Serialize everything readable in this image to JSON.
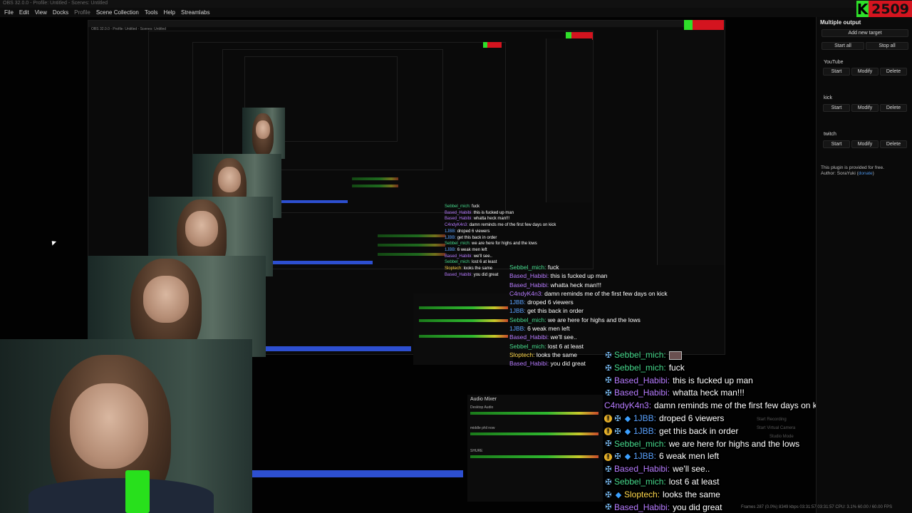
{
  "window": {
    "title": "OBS 32.0.0 - Profile: Untitled - Scenes: Untitled"
  },
  "menubar": {
    "items": [
      "File",
      "Edit",
      "View",
      "Docks",
      "Profile",
      "Scene Collection",
      "Tools",
      "Help",
      "Streamlabs"
    ]
  },
  "kick_badge": {
    "icon_letter": "K",
    "viewer_count": "2509",
    "colors": {
      "icon_bg": "#2fe02a",
      "count_bg": "#d4141f"
    }
  },
  "dock": {
    "title": "Multiple output",
    "add_target": "Add new target",
    "start_all": "Start all",
    "stop_all": "Stop all",
    "targets": [
      {
        "name": "YouTube",
        "start": "Start",
        "modify": "Modify",
        "delete": "Delete"
      },
      {
        "name": "kick",
        "start": "Start",
        "modify": "Modify",
        "delete": "Delete"
      },
      {
        "name": "twitch",
        "start": "Start",
        "modify": "Modify",
        "delete": "Delete"
      }
    ],
    "note_line1": "This plugin is provided for free.",
    "note_line2_prefix": "Author: SoraYuki (",
    "note_link": "donate",
    "note_line2_suffix": ")"
  },
  "mixer": {
    "title": "Audio Mixer",
    "channels": [
      "Desktop Audio",
      "middle phil now",
      "SHURE"
    ]
  },
  "chat": {
    "rows": [
      {
        "badge": "sword",
        "user": "Sebbel_mich:",
        "user_color": "green",
        "text": ""
      },
      {
        "badge": "sword",
        "user": "Sebbel_mich:",
        "user_color": "green",
        "text": "fuck"
      },
      {
        "badge": "sword",
        "user": "Based_Habibi:",
        "user_color": "purple",
        "text": "this is fucked up man"
      },
      {
        "badge": "sword",
        "user": "Based_Habibi:",
        "user_color": "purple",
        "text": "whatta heck man!!!"
      },
      {
        "badge": "",
        "user": "C4ndyK4n3:",
        "user_color": "purple",
        "text": "damn reminds me of the first few days on kick"
      },
      {
        "badge": "gold",
        "user": "1JBB:",
        "user_color": "blue",
        "text": "droped 6 viewers"
      },
      {
        "badge": "gold",
        "user": "1JBB:",
        "user_color": "blue",
        "text": "get this back in order"
      },
      {
        "badge": "sword",
        "user": "Sebbel_mich:",
        "user_color": "green",
        "text": "we are here for highs and the lows"
      },
      {
        "badge": "gold",
        "user": "1JBB:",
        "user_color": "blue",
        "text": "6 weak men left"
      },
      {
        "badge": "sword",
        "user": "Based_Habibi:",
        "user_color": "purple",
        "text": "we'll see.."
      },
      {
        "badge": "sword",
        "user": "Sebbel_mich:",
        "user_color": "green",
        "text": "lost 6 at least"
      },
      {
        "badge": "sword",
        "user": "Sloptech:",
        "user_color": "yellow",
        "text": "looks the same"
      },
      {
        "badge": "sword",
        "user": "Based_Habibi:",
        "user_color": "purple",
        "text": "you did great"
      }
    ]
  },
  "controls": {
    "start_recording": "Start Recording",
    "start_virtual_camera": "Start Virtual Camera",
    "studio_mode": "Studio Mode"
  },
  "status": {
    "text": "Frames 287 (0.0%)   8349 kbps   03:31:57   03:31:57   CPU: 3.1%   60.00 / 60.00 FPS"
  }
}
